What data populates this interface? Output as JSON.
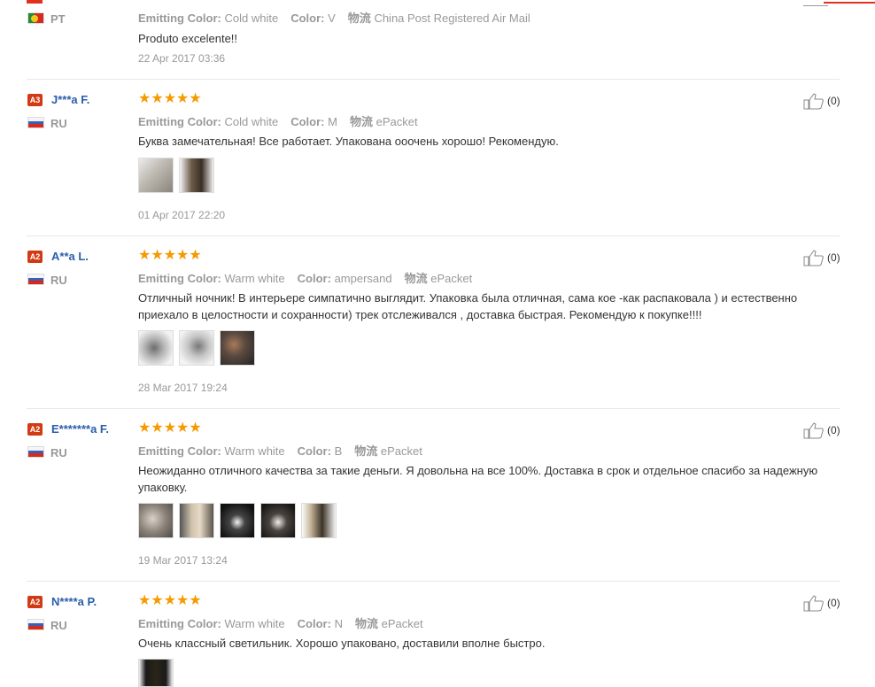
{
  "labels": {
    "emitting_color": "Emitting Color:",
    "color": "Color:",
    "shipping": "物流",
    "useful_count": "(0)"
  },
  "reviews": [
    {
      "rank": "",
      "name": "",
      "country": "PT",
      "emitting_color": "Cold white",
      "color": "V",
      "shipping": "China Post Registered Air Mail",
      "text": "Produto excelente!!",
      "date": "22 Apr 2017 03:36"
    },
    {
      "rank": "A3",
      "name": "J***a F.",
      "country": "RU",
      "stars": "★★★★★",
      "emitting_color": "Cold white",
      "color": "M",
      "shipping": "ePacket",
      "text": "Буква замечательная! Все работает. Упакована ооочень хорошо! Рекомендую.",
      "date": "01 Apr 2017 22:20"
    },
    {
      "rank": "A2",
      "name": "A**a L.",
      "country": "RU",
      "stars": "★★★★★",
      "emitting_color": "Warm white",
      "color": "ampersand",
      "shipping": "ePacket",
      "text": "Отличный ночник! В интерьере симпатично выглядит. Упаковка была отличная, сама кое -как распаковала ) и естественно приехало в целостности и сохранности) трек отслеживался , доставка быстрая. Рекомендую к покупке!!!!",
      "date": "28 Mar 2017 19:24"
    },
    {
      "rank": "A2",
      "name": "E*******a F.",
      "country": "RU",
      "stars": "★★★★★",
      "emitting_color": "Warm white",
      "color": "B",
      "shipping": "ePacket",
      "text": "Неожиданно отличного качества за такие деньги. Я довольна на все 100%. Доставка в срок и отдельное спасибо за надежную упаковку.",
      "date": "19 Mar 2017 13:24"
    },
    {
      "rank": "A2",
      "name": "N****a P.",
      "country": "RU",
      "stars": "★★★★★",
      "emitting_color": "Warm white",
      "color": "N",
      "shipping": "ePacket",
      "text": "Очень классный светильник. Хорошо упаковано, доставили вполне быстро."
    }
  ],
  "colors": {
    "accent": "#e0301e",
    "name_link": "#2a5eab",
    "star": "#f59a00",
    "rank_badge": "#d23a14",
    "muted": "#999999"
  }
}
